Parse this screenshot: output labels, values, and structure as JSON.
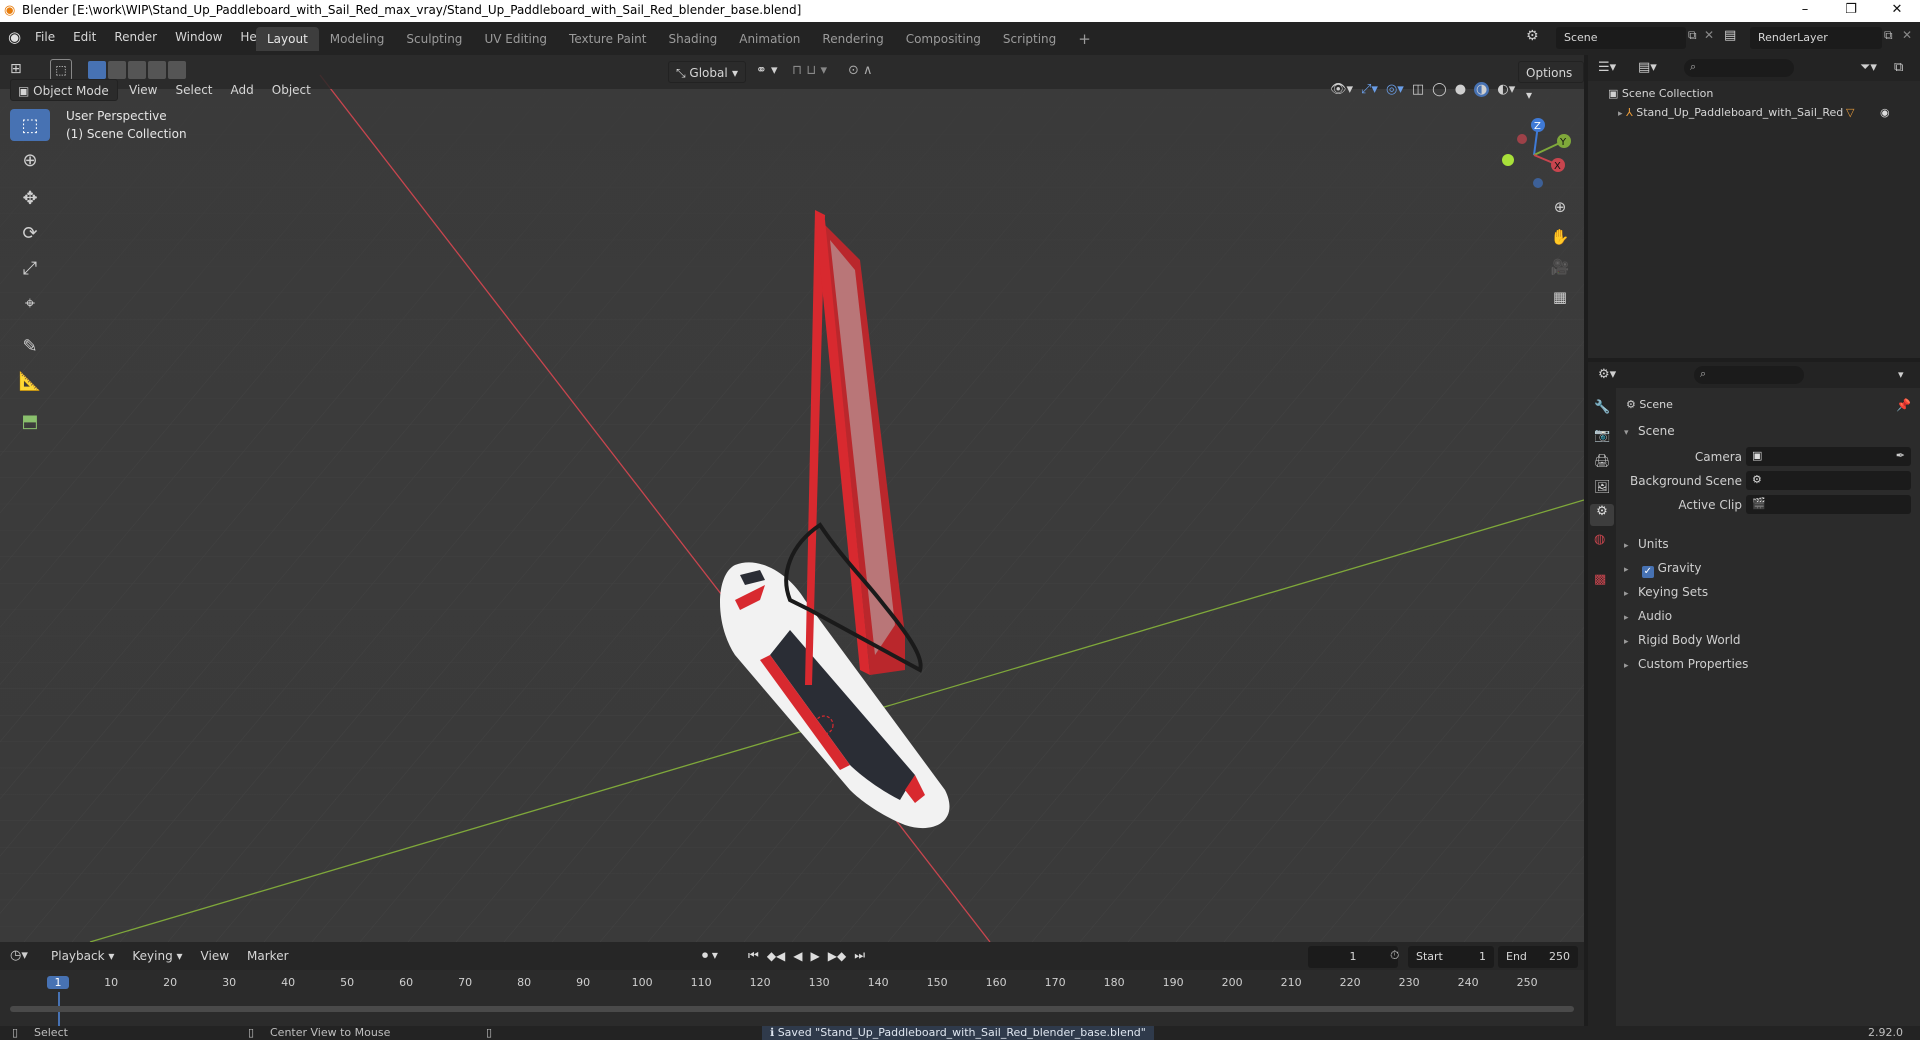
{
  "window": {
    "title": "Blender [E:\\work\\WIP\\Stand_Up_Paddleboard_with_Sail_Red_max_vray/Stand_Up_Paddleboard_with_Sail_Red_blender_base.blend]",
    "minimize": "–",
    "maximize": "❐",
    "close": "✕"
  },
  "menu": [
    "File",
    "Edit",
    "Render",
    "Window",
    "Help"
  ],
  "workspaces": [
    {
      "label": "Layout",
      "active": true
    },
    {
      "label": "Modeling"
    },
    {
      "label": "Sculpting"
    },
    {
      "label": "UV Editing"
    },
    {
      "label": "Texture Paint"
    },
    {
      "label": "Shading"
    },
    {
      "label": "Animation"
    },
    {
      "label": "Rendering"
    },
    {
      "label": "Compositing"
    },
    {
      "label": "Scripting"
    }
  ],
  "add_workspace": "+",
  "scene_field": "Scene",
  "renderlayer_field": "RenderLayer",
  "viewport": {
    "mode": "Object Mode",
    "menus": [
      "View",
      "Select",
      "Add",
      "Object"
    ],
    "transform_orientation": "Global",
    "options": "Options",
    "overlay_text_1": "User Perspective",
    "overlay_text_2": "(1) Scene Collection",
    "gizmo": {
      "x": "X",
      "y": "Y",
      "z": "Z"
    }
  },
  "outliner": {
    "root": "Scene Collection",
    "items": [
      {
        "label": "Stand_Up_Paddleboard_with_Sail_Red"
      }
    ]
  },
  "properties": {
    "context": "Scene",
    "section": "Scene",
    "fields": [
      {
        "label": "Camera"
      },
      {
        "label": "Background Scene"
      },
      {
        "label": "Active Clip"
      }
    ],
    "panels": [
      "Units",
      "Gravity",
      "Keying Sets",
      "Audio",
      "Rigid Body World",
      "Custom Properties"
    ],
    "gravity_checked": true
  },
  "timeline": {
    "menus": [
      "Playback",
      "Keying",
      "View",
      "Marker"
    ],
    "current_frame": "1",
    "start_label": "Start",
    "start": "1",
    "end_label": "End",
    "end": "250",
    "ticks": [
      "1",
      "10",
      "20",
      "30",
      "40",
      "50",
      "60",
      "70",
      "80",
      "90",
      "100",
      "110",
      "120",
      "130",
      "140",
      "150",
      "160",
      "170",
      "180",
      "190",
      "200",
      "210",
      "220",
      "230",
      "240",
      "250"
    ]
  },
  "status": {
    "left": "Select",
    "middle": "Center View to Mouse",
    "message": "Saved \"Stand_Up_Paddleboard_with_Sail_Red_blender_base.blend\"",
    "version": "2.92.0"
  },
  "colors": {
    "accent": "#4772b3",
    "x_axis": "#c8454e",
    "y_axis": "#7fa83a",
    "z_axis": "#3f7ad6",
    "sail_red": "#d8292f"
  }
}
